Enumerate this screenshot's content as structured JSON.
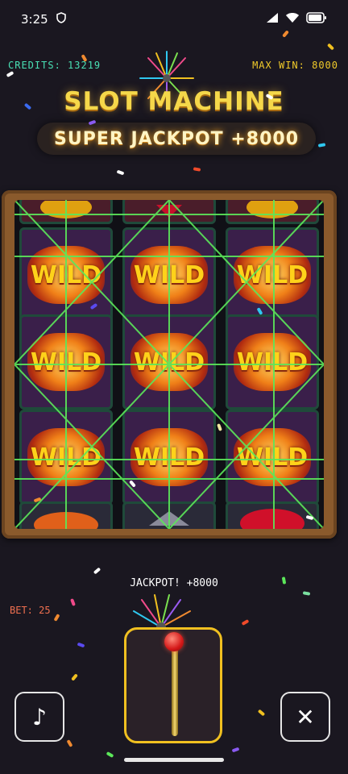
{
  "status_bar": {
    "time": "3:25",
    "shield_icon": "shield-icon",
    "signal_icon": "signal-icon",
    "wifi_icon": "wifi-icon",
    "battery_icon": "battery-icon"
  },
  "hud": {
    "credits_label": "CREDITS: 13219",
    "max_win_label": "MAX WIN: 8000"
  },
  "header": {
    "title": "SLOT MACHINE",
    "jackpot_banner": "SUPER JACKPOT +8000"
  },
  "reels": {
    "symbol_label": "WILD",
    "grid": [
      [
        "WILD",
        "WILD",
        "WILD"
      ],
      [
        "WILD",
        "WILD",
        "WILD"
      ],
      [
        "WILD",
        "WILD",
        "WILD"
      ]
    ],
    "partial_top": [
      "coin",
      "heart",
      "coin"
    ],
    "partial_bottom": [
      "wild",
      "bar",
      "heart"
    ]
  },
  "footer": {
    "jackpot_message": "JACKPOT! +8000",
    "bet_label": "BET: 25",
    "music_icon": "music-note-icon",
    "close_icon": "close-icon",
    "lever_icon": "lever-icon"
  },
  "colors": {
    "background": "#1a1720",
    "gold": "#f0ca2a",
    "credits": "#49e0b4",
    "bet": "#f07050",
    "payline": "#5ce85a"
  }
}
